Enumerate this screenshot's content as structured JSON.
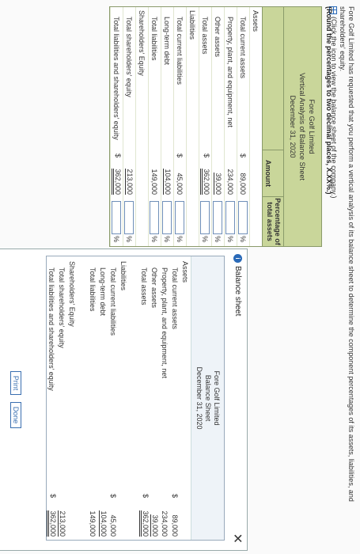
{
  "instructions": {
    "line1": "Fore Golf Limited has requested that you perform a vertical analysis of its balance sheet to determine the component percentages of its assets, liabilities, and shareholders' equity.",
    "line2": "(Click the icon to view the balance sheet of the company.)",
    "rounding": "(Round the percentages to two decimal places, X.XX%.)"
  },
  "worksheet": {
    "company": "Fore Golf Limited",
    "title": "Vertical Analysis of Balance Sheet",
    "date": "December 31, 2020",
    "col_amount": "Amount",
    "col_pct1": "Percentage of",
    "col_pct2": "total assets",
    "rows": [
      {
        "label": "Assets",
        "dollar": "",
        "amount": "",
        "pct": false,
        "indent": false,
        "line": ""
      },
      {
        "label": "Total current assets",
        "dollar": "$",
        "amount": "89,000",
        "pct": true,
        "indent": true,
        "line": ""
      },
      {
        "label": "Property, plant, and equipment, net",
        "dollar": "",
        "amount": "234,000",
        "pct": true,
        "indent": true,
        "line": ""
      },
      {
        "label": "Other assets",
        "dollar": "",
        "amount": "39,000",
        "pct": true,
        "indent": true,
        "line": "sgl"
      },
      {
        "label": "Total assets",
        "dollar": "$",
        "amount": "362,000",
        "pct": true,
        "indent": true,
        "line": "dbl"
      },
      {
        "label": "Liabilities",
        "dollar": "",
        "amount": "",
        "pct": false,
        "indent": false,
        "line": ""
      },
      {
        "label": "Total current liabilities",
        "dollar": "$",
        "amount": "45,000",
        "pct": true,
        "indent": true,
        "line": ""
      },
      {
        "label": "Long-term debt",
        "dollar": "",
        "amount": "104,000",
        "pct": true,
        "indent": true,
        "line": "sgl"
      },
      {
        "label": "Total liabilities",
        "dollar": "",
        "amount": "149,000",
        "pct": true,
        "indent": true,
        "line": ""
      },
      {
        "label": "Shareholders' Equity",
        "dollar": "",
        "amount": "",
        "pct": false,
        "indent": false,
        "line": ""
      },
      {
        "label": "Total shareholders' equity",
        "dollar": "",
        "amount": "213,000",
        "pct": true,
        "indent": true,
        "line": "sgl"
      },
      {
        "label": "Total liabilities and shareholders' equity",
        "dollar": "$",
        "amount": "362,000",
        "pct": true,
        "indent": true,
        "line": "dbl"
      }
    ],
    "pct_symbol": "%"
  },
  "popup": {
    "title": "Balance sheet",
    "close": "✕",
    "company": "Fore Golf Limited",
    "sheet": "Balance Sheet",
    "date": "December 31, 2020",
    "rows": [
      {
        "label": "Assets",
        "dollar": "",
        "amount": "",
        "indent": false,
        "line": ""
      },
      {
        "label": "Total current assets",
        "dollar": "$",
        "amount": "89,000",
        "indent": true,
        "line": ""
      },
      {
        "label": "Property, plant, and equipment, net",
        "dollar": "",
        "amount": "234,000",
        "indent": true,
        "line": ""
      },
      {
        "label": "Other assets",
        "dollar": "",
        "amount": "39,000",
        "indent": true,
        "line": "sgl"
      },
      {
        "label": "Total assets",
        "dollar": "$",
        "amount": "362,000",
        "indent": true,
        "line": "dbl"
      },
      {
        "label": "",
        "dollar": "",
        "amount": "",
        "indent": false,
        "line": ""
      },
      {
        "label": "Liabilities",
        "dollar": "",
        "amount": "",
        "indent": false,
        "line": ""
      },
      {
        "label": "Total current liabilities",
        "dollar": "$",
        "amount": "45,000",
        "indent": true,
        "line": ""
      },
      {
        "label": "Long-term debt",
        "dollar": "",
        "amount": "104,000",
        "indent": true,
        "line": "sgl"
      },
      {
        "label": "Total liabilities",
        "dollar": "",
        "amount": "149,000",
        "indent": true,
        "line": ""
      },
      {
        "label": "",
        "dollar": "",
        "amount": "",
        "indent": false,
        "line": ""
      },
      {
        "label": "Shareholders' Equity",
        "dollar": "",
        "amount": "",
        "indent": false,
        "line": ""
      },
      {
        "label": "Total shareholders' equity",
        "dollar": "",
        "amount": "213,000",
        "indent": true,
        "line": "sgl"
      },
      {
        "label": "Total liabilities and shareholders' equity",
        "dollar": "$",
        "amount": "362,000",
        "indent": true,
        "line": "dbl"
      }
    ],
    "print": "Print",
    "done": "Done"
  },
  "colors": {
    "header_green": "#c9d69a",
    "link_blue": "#2a6ab8"
  }
}
